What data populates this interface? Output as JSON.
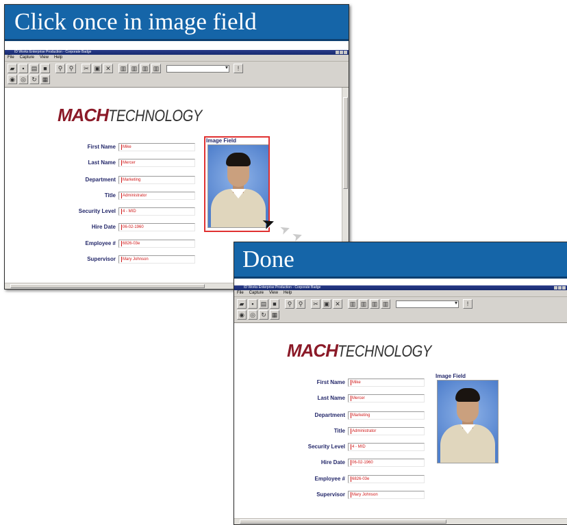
{
  "panel_before": {
    "banner": "Click once in image field",
    "window_title": "ID Works Enterprise Production - Corporate Badge",
    "menu": [
      "File",
      "Capture",
      "View",
      "Help"
    ]
  },
  "panel_after": {
    "banner": "Done",
    "window_title": "ID Works Enterprise Production - Corporate Badge",
    "menu": [
      "File",
      "Capture",
      "View",
      "Help"
    ]
  },
  "logo": {
    "bold": "MACH",
    "light": "TECHNOLOGY"
  },
  "image_field_label": "Image Field",
  "form": {
    "first_name": {
      "label": "First Name",
      "value": "Mike"
    },
    "last_name": {
      "label": "Last Name",
      "value": "Mercer"
    },
    "department": {
      "label": "Department",
      "value": "Marketing"
    },
    "title": {
      "label": "Title",
      "value": "Administrator"
    },
    "security_level": {
      "label": "Security Level",
      "value": "4 - MID"
    },
    "hire_date": {
      "label": "Hire Date",
      "value": "06-02-1960"
    },
    "employee_number": {
      "label": "Employee #",
      "value": "6826-03e"
    },
    "supervisor": {
      "label": "Supervisor",
      "value": "Mary Johnson"
    }
  },
  "colors": {
    "banner": "#1565a8",
    "logo_mach": "#8b1a28",
    "field_label": "#24286a",
    "field_value": "#d01818",
    "selection": "#e03030"
  },
  "icons": [
    "open-icon",
    "save-icon",
    "print-icon",
    "zoom-in-icon",
    "zoom-out-icon",
    "cut-icon",
    "copy-icon",
    "delete-icon",
    "align-icon",
    "capture-icon"
  ]
}
